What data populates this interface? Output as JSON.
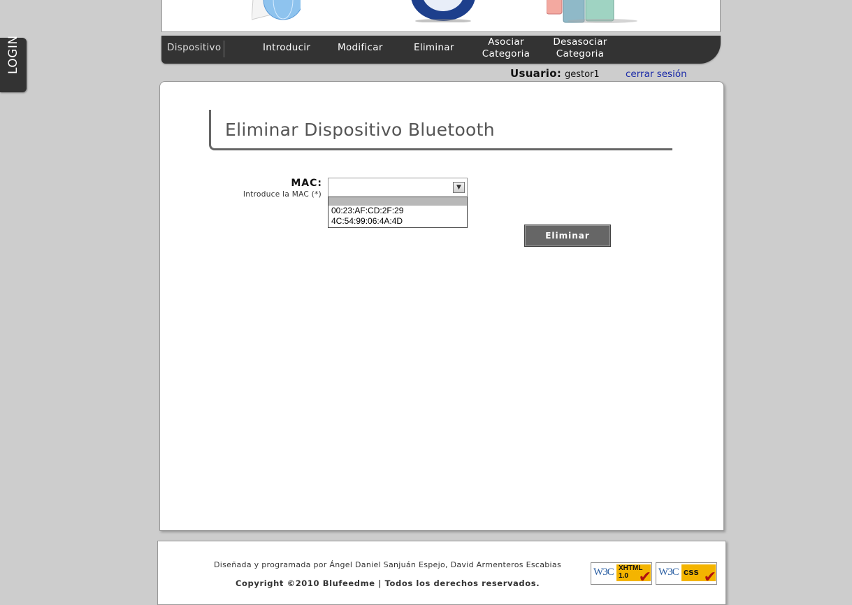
{
  "login_tab": {
    "label": "LOGIN"
  },
  "nav": {
    "section": "Dispositivo",
    "items": [
      {
        "label": "Introducir"
      },
      {
        "label": "Modificar"
      },
      {
        "label": "Eliminar"
      },
      {
        "label": "Asociar Categoria"
      },
      {
        "label": "Desasociar Categoria"
      }
    ]
  },
  "user": {
    "label": "Usuario:",
    "name": "gestor1",
    "logout": "cerrar sesión"
  },
  "form": {
    "title": "Eliminar Dispositivo Bluetooth",
    "mac_label": "MAC:",
    "mac_hint": "Introduce la MAC (*)",
    "mac_value": "",
    "mac_options": [
      "",
      "00:23:AF:CD:2F:29",
      "4C:54:99:06:4A:4D"
    ],
    "submit": "Eliminar"
  },
  "footer": {
    "credits": "Diseñada y programada por Ángel Daniel Sanjuán Espejo, David Armenteros Escabias",
    "copyright": "Copyright ©2010 Blufeedme | Todos los derechos reservados.",
    "badges": [
      {
        "org": "W3C",
        "label": "XHTML 1.0"
      },
      {
        "org": "W3C",
        "label": "css"
      }
    ]
  },
  "colors": {
    "nav_bg": "#333333",
    "link": "#1a2aa8",
    "button_bg": "#666666"
  }
}
